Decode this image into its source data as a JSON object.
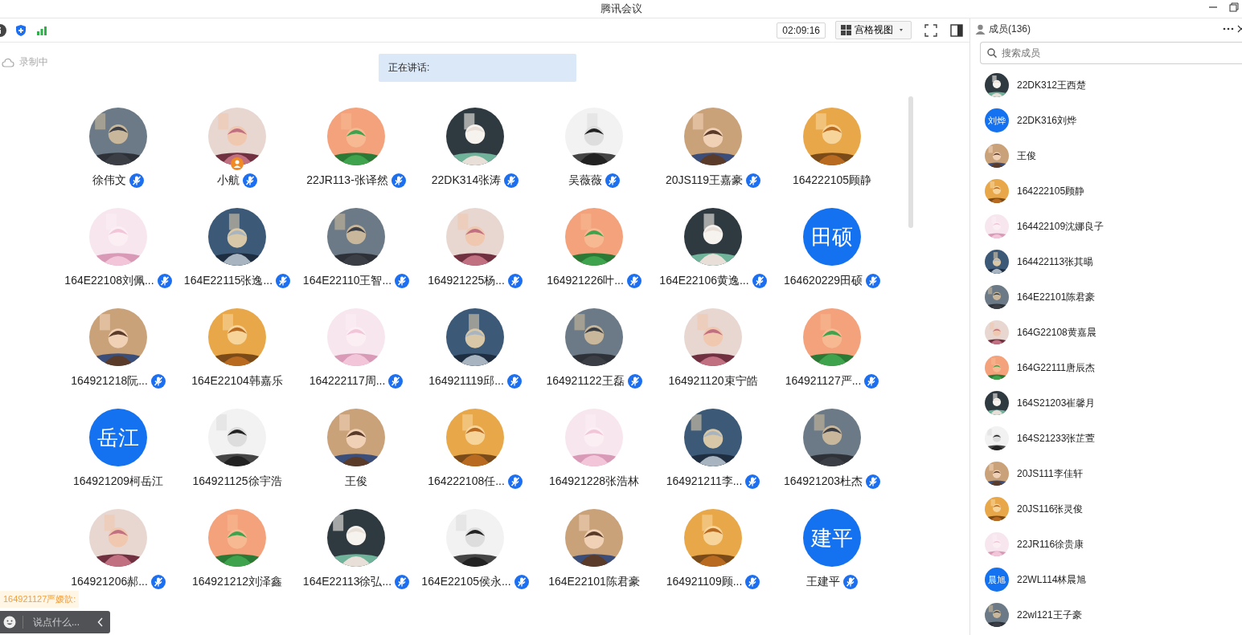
{
  "window": {
    "title": "腾讯会议"
  },
  "toolbar": {
    "timer": "02:09:16",
    "view_button": "宫格视图"
  },
  "recording": {
    "label": "录制中"
  },
  "speaking": {
    "label": "正在讲话:"
  },
  "tiles": [
    {
      "name": "徐伟文",
      "muted": true,
      "host": false
    },
    {
      "name": "小航",
      "muted": true,
      "host": true
    },
    {
      "name": "22JR113-张译然",
      "muted": true,
      "host": false
    },
    {
      "name": "22DK314张涛",
      "muted": true,
      "host": false
    },
    {
      "name": "吴薇薇",
      "muted": true,
      "host": false
    },
    {
      "name": "20JS119王嘉豪",
      "muted": true,
      "host": false
    },
    {
      "name": "164222105顾静",
      "muted": false,
      "host": false
    },
    {
      "name": "164E22108刘佩...",
      "muted": true,
      "host": false
    },
    {
      "name": "164E22115张逸...",
      "muted": true,
      "host": false
    },
    {
      "name": "164E22110王智...",
      "muted": true,
      "host": false
    },
    {
      "name": "164921225杨...",
      "muted": true,
      "host": false
    },
    {
      "name": "164921226叶...",
      "muted": true,
      "host": false
    },
    {
      "name": "164E22106黄逸...",
      "muted": true,
      "host": false
    },
    {
      "name": "164620229田硕",
      "avatar": {
        "kind": "initials",
        "initials": "田硕"
      },
      "muted": true,
      "host": false
    },
    {
      "name": "164921218阮...",
      "muted": true,
      "host": false
    },
    {
      "name": "164E22104韩嘉乐",
      "muted": false,
      "host": false
    },
    {
      "name": "164222117周...",
      "muted": true,
      "host": false
    },
    {
      "name": "164921119邱...",
      "muted": true,
      "host": false
    },
    {
      "name": "164921122王磊",
      "muted": true,
      "host": false
    },
    {
      "name": "164921120束宁皓",
      "muted": false,
      "host": false
    },
    {
      "name": "164921127严...",
      "muted": true,
      "host": false
    },
    {
      "name": "164921209柯岳江",
      "avatar": {
        "kind": "initials",
        "initials": "岳江"
      },
      "muted": false,
      "host": false
    },
    {
      "name": "164921125徐宇浩",
      "muted": false,
      "host": false
    },
    {
      "name": "王俊",
      "muted": false,
      "host": false
    },
    {
      "name": "164222108任...",
      "muted": true,
      "host": false
    },
    {
      "name": "164921228张浩林",
      "muted": false,
      "host": false
    },
    {
      "name": "164921211李...",
      "muted": true,
      "host": false
    },
    {
      "name": "164921203杜杰",
      "muted": true,
      "host": false
    },
    {
      "name": "164921206郝...",
      "muted": true,
      "host": false
    },
    {
      "name": "164921212刘泽鑫",
      "muted": false,
      "host": false
    },
    {
      "name": "164E22113徐弘...",
      "muted": true,
      "host": false
    },
    {
      "name": "164E22105侯永...",
      "muted": true,
      "host": false
    },
    {
      "name": "164E22101陈君豪",
      "muted": false,
      "host": false
    },
    {
      "name": "164921109顾...",
      "muted": true,
      "host": false
    },
    {
      "name": "王建平",
      "avatar": {
        "kind": "initials",
        "initials": "建平"
      },
      "muted": true,
      "host": false
    }
  ],
  "chat": {
    "message": "164921127严嫒歆:",
    "placeholder": "说点什么..."
  },
  "members": {
    "title": "成员(136)",
    "search_placeholder": "搜索成员",
    "items": [
      {
        "name": "22DK312王西楚"
      },
      {
        "name": "22DK316刘烨",
        "avatar": {
          "kind": "initials",
          "initials": "刘烨"
        }
      },
      {
        "name": "王俊"
      },
      {
        "name": "164222105顾静"
      },
      {
        "name": "164422109沈娜良子"
      },
      {
        "name": "164422113张其暘"
      },
      {
        "name": "164E22101陈君豪"
      },
      {
        "name": "164G22108黄嘉晨"
      },
      {
        "name": "164G22111唐辰杰"
      },
      {
        "name": "164S21203崔馨月"
      },
      {
        "name": "164S21233张芷萱"
      },
      {
        "name": "20JS111李佳轩"
      },
      {
        "name": "20JS116张灵俊"
      },
      {
        "name": "22JR116徐贵康"
      },
      {
        "name": "22WL114林晨旭",
        "avatar": {
          "kind": "initials",
          "initials": "晨旭"
        }
      },
      {
        "name": "22wl121王子豪"
      }
    ]
  }
}
